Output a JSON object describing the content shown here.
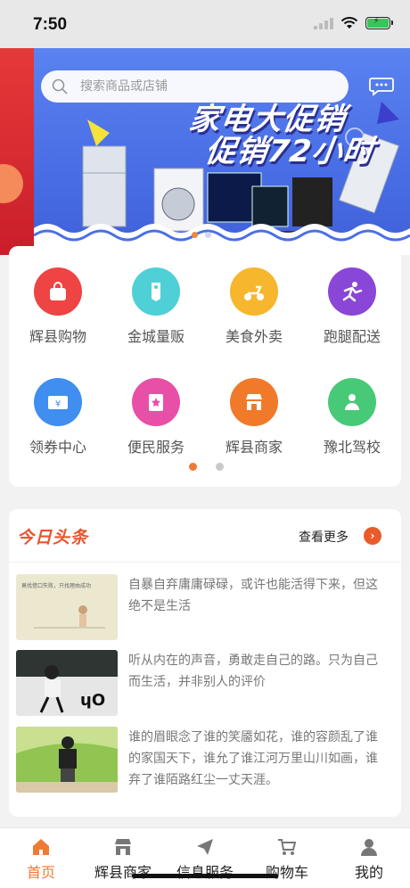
{
  "status_bar": {
    "time": "7:50"
  },
  "search": {
    "placeholder": "搜索商品或店铺"
  },
  "banner": {
    "line1": "家电大促销",
    "line2": "促销72小时"
  },
  "categories": [
    {
      "label": "辉县购物",
      "icon": "shopping-bag-icon",
      "color": "#ee4444"
    },
    {
      "label": "金城量贩",
      "icon": "price-tag-icon",
      "color": "#4fcfd6"
    },
    {
      "label": "美食外卖",
      "icon": "scooter-icon",
      "color": "#f6b62d"
    },
    {
      "label": "跑腿配送",
      "icon": "runner-icon",
      "color": "#8a46d6"
    },
    {
      "label": "领券中心",
      "icon": "coupon-icon",
      "color": "#3f8ef0"
    },
    {
      "label": "便民服务",
      "icon": "service-icon",
      "color": "#e84fa6"
    },
    {
      "label": "辉县商家",
      "icon": "store-icon",
      "color": "#f07a2a"
    },
    {
      "label": "豫北驾校",
      "icon": "driver-icon",
      "color": "#48c978"
    }
  ],
  "news": {
    "title": "今日头条",
    "more": "查看更多",
    "thumb1_caption": "莫找借口失败，只找理由成功",
    "items": [
      {
        "text": "自暴自弃庸庸碌碌，或许也能活得下来，但这绝不是生活"
      },
      {
        "text": "听从内在的声音，勇敢走自己的路。只为自己而生活，并非别人的评价"
      },
      {
        "text": "谁的眉眼念了谁的笑靥如花，谁的容颜乱了谁的家国天下，谁允了谁江河万里山川如画，谁弃了谁陌路红尘一丈天涯。"
      }
    ]
  },
  "tabs": [
    {
      "label": "首页",
      "icon": "home-icon",
      "active": true
    },
    {
      "label": "辉县商家",
      "icon": "store-icon",
      "active": false
    },
    {
      "label": "信息服务",
      "icon": "paper-plane-icon",
      "active": false
    },
    {
      "label": "购物车",
      "icon": "cart-icon",
      "active": false
    },
    {
      "label": "我的",
      "icon": "user-icon",
      "active": false
    }
  ],
  "colors": {
    "accent": "#ef7a35",
    "banner_blue": "#4a6fe6",
    "news_title": "#e8542a"
  }
}
